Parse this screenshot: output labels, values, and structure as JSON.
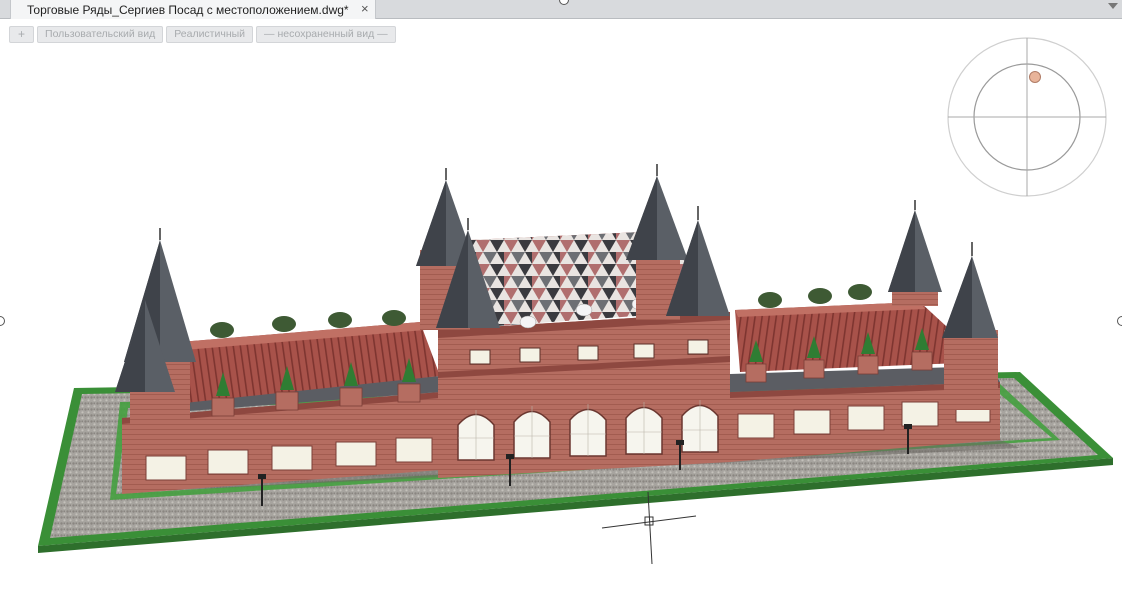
{
  "document_tab": {
    "title": "Торговые Ряды_Сергиев Посад с местоположением.dwg*",
    "close_glyph": "×"
  },
  "viewport_controls": {
    "plus_label": "+",
    "view_label": "Пользовательский вид",
    "style_label": "Реалистичный",
    "saved_view_label": "— несохраненный вид —"
  },
  "scene": {
    "model": "trading-rows-building",
    "colors": {
      "brick": "#b36a5e",
      "roof": "#a04a42",
      "spire": "#5a5f66",
      "grass": "#3f9e3a",
      "paving": "#9c9994",
      "window": "#f3f1e6"
    }
  },
  "compass": {
    "icon": "view-compass-icon",
    "marker_color": "#e8b49a"
  },
  "cursor": {
    "icon": "crosshair-cursor-icon"
  }
}
